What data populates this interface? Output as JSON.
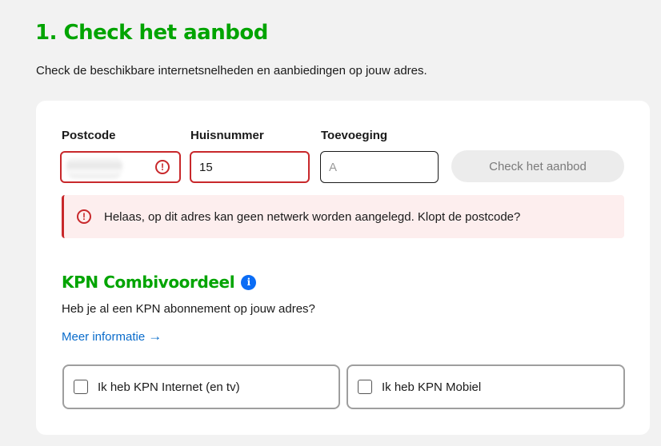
{
  "header": {
    "title": "1. Check het aanbod",
    "intro": "Check de beschikbare internetsnelheden en aanbiedingen op jouw adres."
  },
  "form": {
    "postcode": {
      "label": "Postcode",
      "value": ""
    },
    "huisnummer": {
      "label": "Huisnummer",
      "value": "15"
    },
    "toevoeging": {
      "label": "Toevoeging",
      "placeholder": "A"
    },
    "submit_label": "Check het aanbod",
    "error_icon": "!"
  },
  "alert": {
    "icon": "!",
    "message": "Helaas, op dit adres kan geen netwerk worden aangelegd. Klopt de postcode?"
  },
  "combivoordeel": {
    "title": "KPN Combivoordeel",
    "info_icon": "i",
    "question": "Heb je al een KPN abonnement op jouw adres?",
    "link_label": "Meer informatie",
    "link_arrow": "→",
    "options": [
      {
        "label": "Ik heb KPN Internet (en tv)"
      },
      {
        "label": "Ik heb KPN Mobiel"
      }
    ]
  },
  "colors": {
    "brand_green": "#00a400",
    "error_red": "#c8282b",
    "link_blue": "#0a6ccb",
    "info_blue": "#0a6cf5"
  }
}
